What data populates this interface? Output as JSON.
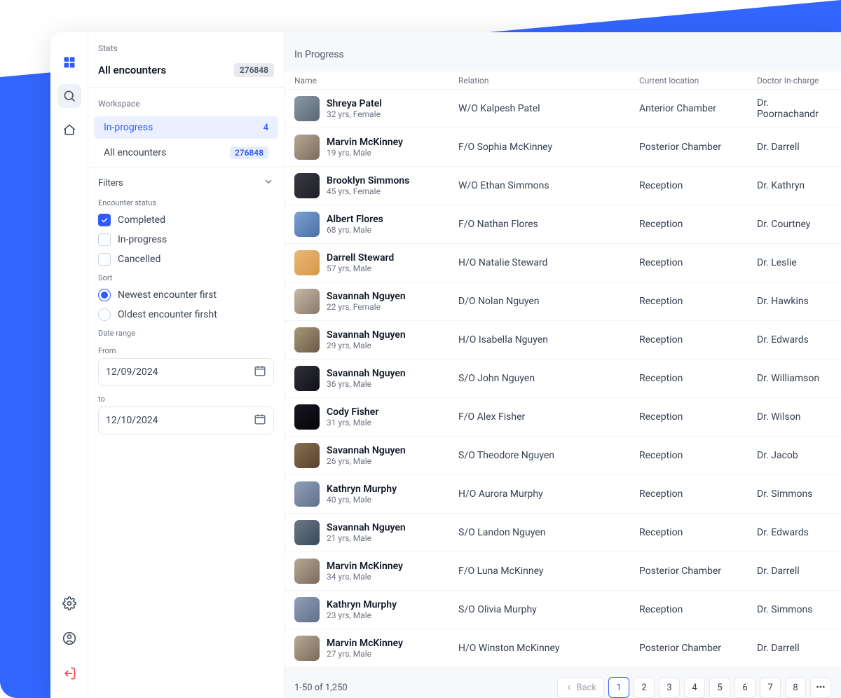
{
  "sidebar": {
    "stats_label": "Stats",
    "stats_title": "All encounters",
    "stats_count": "276848",
    "workspace_label": "Workspace",
    "workspace": [
      {
        "label": "In-progress",
        "count": "4",
        "active": true
      },
      {
        "label": "All encounters",
        "count": "276848",
        "active": false
      }
    ],
    "filters_label": "Filters",
    "encounter_status_label": "Encounter status",
    "status_options": [
      {
        "label": "Completed",
        "checked": true
      },
      {
        "label": "In-progress",
        "checked": false
      },
      {
        "label": "Cancelled",
        "checked": false
      }
    ],
    "sort_label": "Sort",
    "sort_options": [
      {
        "label": "Newest encounter first",
        "checked": true
      },
      {
        "label": "Oldest encounter firsht",
        "checked": false
      }
    ],
    "date_range_label": "Date range",
    "date_from_label": "From",
    "date_from_value": "12/09/2024",
    "date_to_label": "to",
    "date_to_value": "12/10/2024"
  },
  "main": {
    "title": "In Progress",
    "columns": {
      "name": "Name",
      "relation": "Relation",
      "location": "Current location",
      "doctor": "Doctor In-charge"
    },
    "rows": [
      {
        "name": "Shreya Patel",
        "meta": "32 yrs, Female",
        "relation": "W/O Kalpesh Patel",
        "location": "Anterior Chamber",
        "doctor": "Dr. Poornachandr"
      },
      {
        "name": "Marvin McKinney",
        "meta": "19 yrs, Male",
        "relation": "F/O Sophia McKinney",
        "location": "Posterior Chamber",
        "doctor": "Dr. Darrell"
      },
      {
        "name": "Brooklyn Simmons",
        "meta": "45 yrs, Female",
        "relation": "W/O Ethan Simmons",
        "location": "Reception",
        "doctor": "Dr. Kathryn"
      },
      {
        "name": "Albert Flores",
        "meta": "68 yrs, Male",
        "relation": "F/O Nathan Flores",
        "location": "Reception",
        "doctor": "Dr. Courtney"
      },
      {
        "name": "Darrell Steward",
        "meta": "57 yrs, Male",
        "relation": "H/O Natalie Steward",
        "location": "Reception",
        "doctor": "Dr. Leslie"
      },
      {
        "name": "Savannah Nguyen",
        "meta": "22 yrs, Female",
        "relation": "D/O Nolan Nguyen",
        "location": "Reception",
        "doctor": "Dr. Hawkins"
      },
      {
        "name": "Savannah Nguyen",
        "meta": "29 yrs, Male",
        "relation": "H/O Isabella Nguyen",
        "location": "Reception",
        "doctor": "Dr. Edwards"
      },
      {
        "name": "Savannah Nguyen",
        "meta": "36 yrs, Male",
        "relation": "S/O John Nguyen",
        "location": "Reception",
        "doctor": "Dr. Williamson"
      },
      {
        "name": "Cody Fisher",
        "meta": "31 yrs, Male",
        "relation": "F/O Alex Fisher",
        "location": "Reception",
        "doctor": "Dr. Wilson"
      },
      {
        "name": "Savannah Nguyen",
        "meta": "26 yrs, Male",
        "relation": "S/O Theodore Nguyen",
        "location": "Reception",
        "doctor": "Dr. Jacob"
      },
      {
        "name": "Kathryn Murphy",
        "meta": "40 yrs, Male",
        "relation": "H/O Aurora Murphy",
        "location": "Reception",
        "doctor": "Dr. Simmons"
      },
      {
        "name": "Savannah Nguyen",
        "meta": "21 yrs, Male",
        "relation": "S/O Landon Nguyen",
        "location": "Reception",
        "doctor": "Dr. Edwards"
      },
      {
        "name": "Marvin McKinney",
        "meta": "34 yrs, Male",
        "relation": "F/O Luna McKinney",
        "location": "Posterior Chamber",
        "doctor": "Dr. Darrell"
      },
      {
        "name": "Kathryn Murphy",
        "meta": "23 yrs, Male",
        "relation": "S/O Olivia Murphy",
        "location": "Reception",
        "doctor": "Dr. Simmons"
      },
      {
        "name": "Marvin McKinney",
        "meta": "27 yrs, Male",
        "relation": "H/O Winston McKinney",
        "location": "Posterior Chamber",
        "doctor": "Dr. Darrell"
      }
    ],
    "footer_range": "1-50 of 1,250",
    "pager_back": "Back",
    "pages": [
      "1",
      "2",
      "3",
      "4",
      "5",
      "6",
      "7",
      "8"
    ],
    "active_page": "1"
  }
}
